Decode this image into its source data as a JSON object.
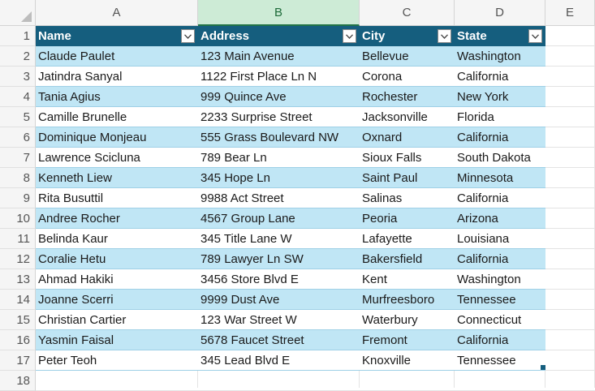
{
  "columns": [
    "A",
    "B",
    "C",
    "D",
    "E"
  ],
  "row_numbers": [
    "1",
    "2",
    "3",
    "4",
    "5",
    "6",
    "7",
    "8",
    "9",
    "10",
    "11",
    "12",
    "13",
    "14",
    "15",
    "16",
    "17",
    "18"
  ],
  "table": {
    "headers": [
      "Name",
      "Address",
      "City",
      "State"
    ],
    "rows": [
      [
        "Claude Paulet",
        "123 Main Avenue",
        "Bellevue",
        "Washington"
      ],
      [
        "Jatindra Sanyal",
        "1122 First Place Ln N",
        "Corona",
        "California"
      ],
      [
        "Tania Agius",
        "999 Quince Ave",
        "Rochester",
        "New York"
      ],
      [
        "Camille Brunelle",
        "2233 Surprise Street",
        "Jacksonville",
        "Florida"
      ],
      [
        "Dominique Monjeau",
        "555 Grass Boulevard NW",
        "Oxnard",
        "California"
      ],
      [
        "Lawrence Scicluna",
        "789 Bear Ln",
        "Sioux Falls",
        "South Dakota"
      ],
      [
        "Kenneth Liew",
        "345 Hope Ln",
        "Saint Paul",
        "Minnesota"
      ],
      [
        "Rita Busuttil",
        "9988 Act Street",
        "Salinas",
        "California"
      ],
      [
        "Andree Rocher",
        "4567 Group Lane",
        "Peoria",
        "Arizona"
      ],
      [
        "Belinda Kaur",
        "345 Title Lane W",
        "Lafayette",
        "Louisiana"
      ],
      [
        "Coralie Hetu",
        "789 Lawyer Ln SW",
        "Bakersfield",
        "California"
      ],
      [
        "Ahmad Hakiki",
        "3456 Store Blvd E",
        "Kent",
        "Washington"
      ],
      [
        "Joanne Scerri",
        "9999 Dust Ave",
        "Murfreesboro",
        "Tennessee"
      ],
      [
        "Christian Cartier",
        "123 War Street W",
        "Waterbury",
        "Connecticut"
      ],
      [
        "Yasmin Faisal",
        "5678 Faucet Street",
        "Fremont",
        "California"
      ],
      [
        "Peter Teoh",
        "345 Lead Blvd E",
        "Knoxville",
        "Tennessee"
      ]
    ]
  },
  "selected_column": "B",
  "colors": {
    "header_bg": "#155e7e",
    "band_bg": "#c0e6f5",
    "selected_col_bg": "#cdebd6"
  },
  "icons": {
    "filter": "chevron-down-icon",
    "select_all": "select-all-triangle-icon"
  }
}
